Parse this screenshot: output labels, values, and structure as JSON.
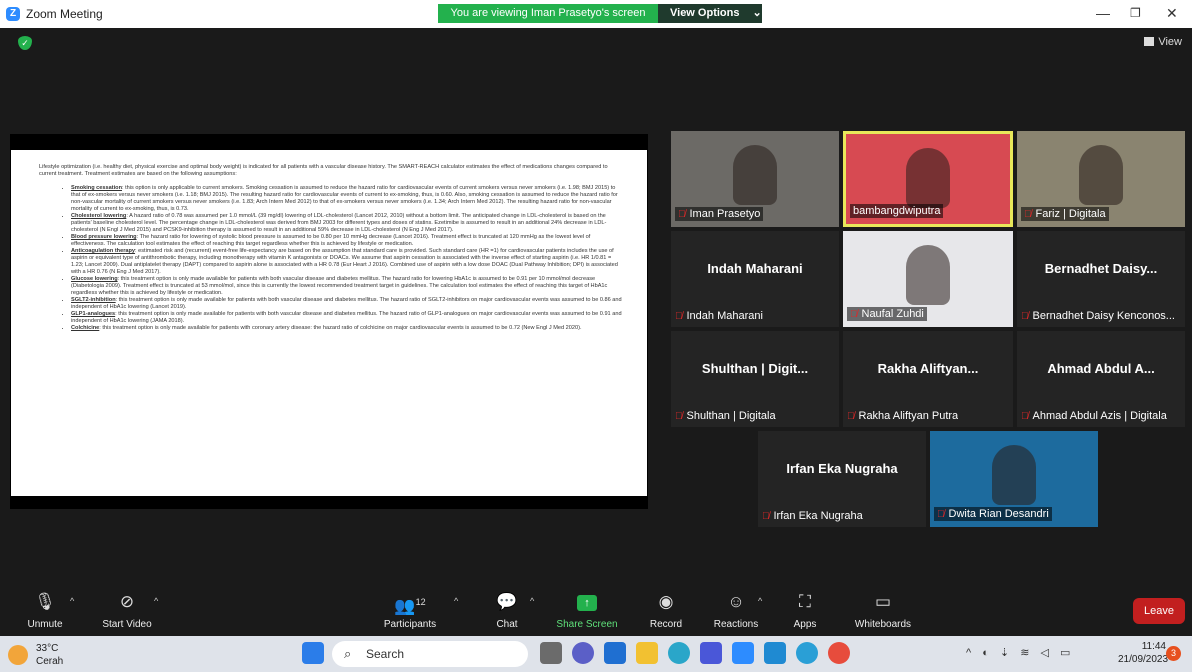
{
  "window": {
    "app_title": "Zoom Meeting",
    "share_banner": "You are viewing Iman Prasetyo's screen",
    "view_options": "View Options"
  },
  "top": {
    "view_label": "View"
  },
  "doc": {
    "intro": "Lifestyle optimization (i.e. healthy diet, physical exercise and optimal body weight) is indicated for all patients with a vascular disease history. The SMART-REACH calculator estimates the effect of medications changes compared to current treatment. Treatment estimates are based on the following assumptions:",
    "items": [
      {
        "head": "Smoking cessation",
        "body": ": this option is only applicable to current smokers. Smoking cessation is assumed to reduce the hazard ratio for cardiovascular events of current smokers versus never smokers (i.e. 1.98; BMJ 2015) to that of ex-smokers versus never smokers (i.e. 1.18; BMJ 2015). The resulting hazard ratio for cardiovascular events of current to ex-smoking, thus, is 0.60. Also, smoking cessation is assumed to reduce the hazard ratio for non-vascular mortality of current smokers versus never smokers (i.e. 1.83; Arch Intern Med 2012) to that of ex-smokers versus never smokers (i.e. 1.34; Arch Intern Med 2012). The resulting hazard ratio for non-vascular mortality of current to ex-smoking, thus, is 0.73."
      },
      {
        "head": "Cholesterol lowering",
        "body": ": A hazard ratio of 0.78 was assumed per 1.0 mmol/L (39 mg/dl) lowering of LDL-cholesterol (Lancet 2012, 2010) without a bottom limit. The anticipated change in LDL-cholesterol is based on the patients' baseline cholesterol level. The percentage change in LDL-cholesterol was derived from BMJ 2003 for different types and doses of statins. Ezetimibe is assumed to result in an additional 24% decrease in LDL-cholesterol (N Engl J Med 2015) and PCSK9-inhibition therapy is assumed to result in an additional 59% decrease in LDL-cholesterol (N Eng J Med 2017)."
      },
      {
        "head": "Blood pressure lowering",
        "body": ": The hazard ratio for lowering of systolic blood pressure is assumed to be 0.80 per 10 mmHg decrease (Lancet 2016). Treatment effect is truncated at 120 mmHg as the lowest level of effectiveness. The calculation tool estimates the effect of reaching this target regardless whether this is achieved by lifestyle or medication."
      },
      {
        "head": "Anticoagulation therapy",
        "body": ": estimated risk and (recurrent) event-free life-expectancy are based on the assumption that standard care is provided. Such standard care (HR =1) for cardiovascular patients includes the use of aspirin or equivalent type of antithrombotic therapy, including monotherapy with vitamin K antagonists or DOACs. We assume that aspirin cessation is associated with the inverse effect of starting aspirin (i.e. HR 1/0.81 = 1.23; Lancet 2009). Dual antiplatelet therapy (DAPT) compared to aspirin alone is associated with a HR 0.78 (Eur Heart J 2016). Combined use of aspirin with a low dose DOAC (Dual Pathway Inhibition; DPI) is associated with a HR 0.76 (N Eng J Med 2017)."
      },
      {
        "head": "Glucose lowering",
        "body": ": this treatment option is only made available for patients with both vascular disease and diabetes mellitus. The hazard ratio for lowering HbA1c is assumed to be 0.91 per 10 mmol/mol decrease (Diabetologia 2009). Treatment effect is truncated at 53 mmol/mol, since this is currently the lowest recommended treatment target in guidelines. The calculation tool estimates the effect of reaching this target of HbA1c regardless whether this is achieved by lifestyle or medication."
      },
      {
        "head": "SGLT2-inhibition",
        "body": ": this treatment option is only made available for patients with both vascular disease and diabetes mellitus. The hazard ratio of SGLT2-inhibitors on major cardiovascular events was assumed to be 0.86 and independent of HbA1c lowering (Lancet 2019)."
      },
      {
        "head": "GLP1-analogues",
        "body": ": this treatment option is only made available for patients with both vascular disease and diabetes mellitus. The hazard ratio of GLP1-analogues on major cardiovascular events was assumed to be 0.91 and independent of HbA1c lowering (JAMA 2018)."
      },
      {
        "head": "Colchicine",
        "body": ": this treatment option is only made available for patients with coronary artery disease: the hazard ratio of colchicine on major cardiovascular events is assumed to be 0.72 (New Engl J Med 2020)."
      }
    ]
  },
  "participants": [
    {
      "label": "Iman Prasetyo",
      "center": "",
      "video": true,
      "muted": true
    },
    {
      "label": "bambangdwiputra",
      "center": "",
      "video": true,
      "muted": false
    },
    {
      "label": "Fariz | Digitala",
      "center": "",
      "video": true,
      "muted": true
    },
    {
      "label": "Indah Maharani",
      "center": "Indah Maharani",
      "video": false,
      "muted": true
    },
    {
      "label": "Naufal Zuhdi",
      "center": "",
      "video": true,
      "muted": true
    },
    {
      "label": "Bernadhet Daisy Kenconos...",
      "center": "Bernadhet Daisy...",
      "video": false,
      "muted": true
    },
    {
      "label": "Shulthan | Digitala",
      "center": "Shulthan | Digit...",
      "video": false,
      "muted": true
    },
    {
      "label": "Rakha Aliftyan Putra",
      "center": "Rakha Aliftyan...",
      "video": false,
      "muted": true
    },
    {
      "label": "Ahmad Abdul Azis | Digitala",
      "center": "Ahmad Abdul A...",
      "video": false,
      "muted": true
    },
    {
      "label": "Irfan Eka Nugraha",
      "center": "Irfan Eka Nugraha",
      "video": false,
      "muted": true
    },
    {
      "label": "Dwita Rian Desandri",
      "center": "",
      "video": true,
      "muted": true
    }
  ],
  "toolbar": {
    "unmute": "Unmute",
    "start_video": "Start Video",
    "participants": "Participants",
    "participant_count": "12",
    "chat": "Chat",
    "share_screen": "Share Screen",
    "record": "Record",
    "reactions": "Reactions",
    "apps": "Apps",
    "whiteboards": "Whiteboards",
    "leave": "Leave"
  },
  "taskbar": {
    "temp": "33°C",
    "condition": "Cerah",
    "search_placeholder": "Search",
    "time": "11:44",
    "date": "21/09/2023",
    "notif_count": "3"
  }
}
